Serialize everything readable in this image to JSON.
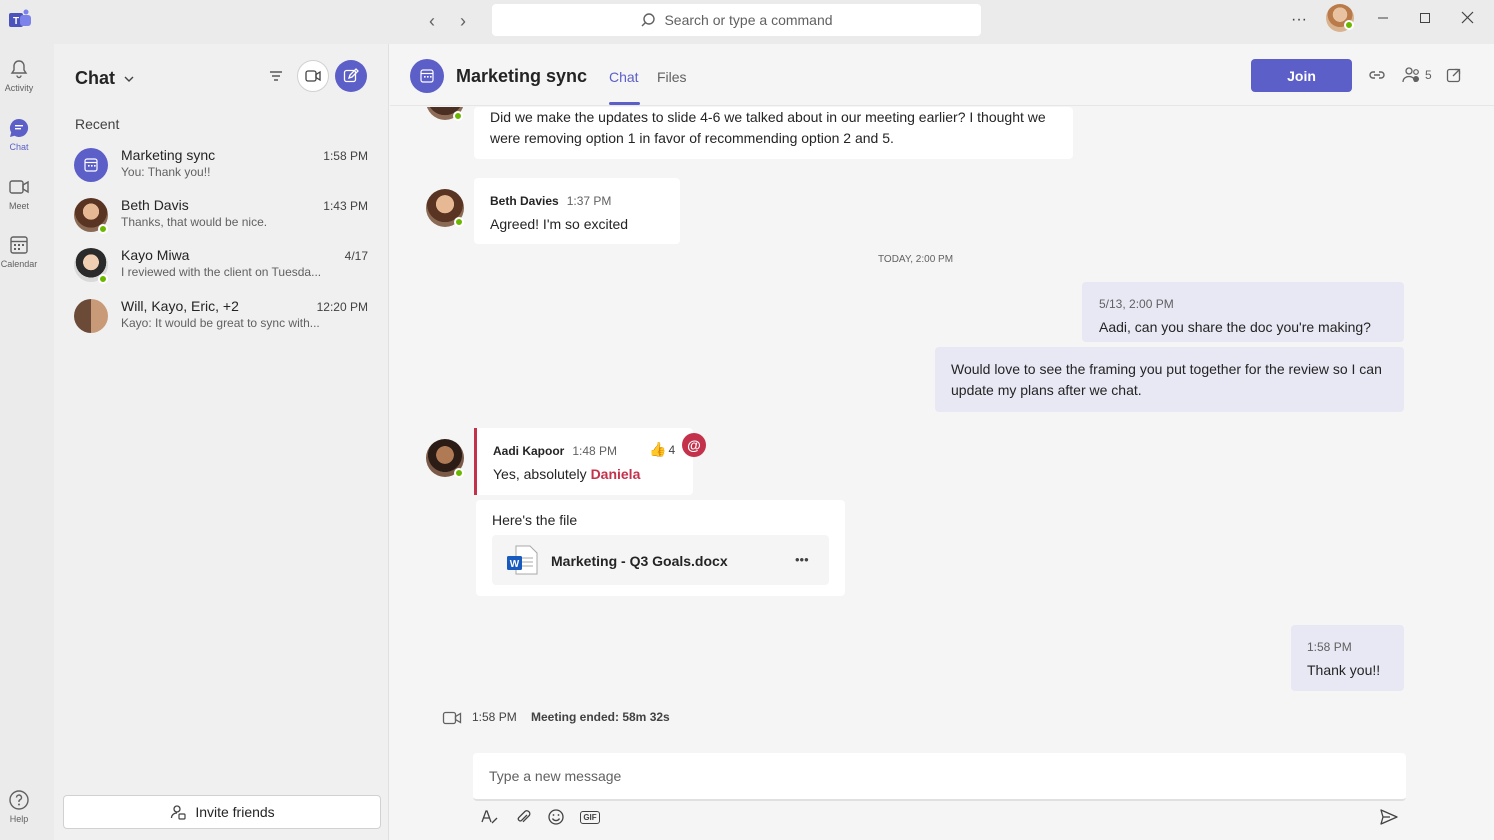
{
  "titlebar": {
    "search_placeholder": "Search or type a command",
    "more": "···"
  },
  "rail": {
    "items": [
      {
        "label": "Activity"
      },
      {
        "label": "Chat"
      },
      {
        "label": "Meet"
      },
      {
        "label": "Calendar"
      },
      {
        "label": "Help"
      }
    ]
  },
  "chatlist": {
    "title": "Chat",
    "recent_label": "Recent",
    "chats": [
      {
        "name": "Marketing sync",
        "preview": "You: Thank you!!",
        "time": "1:58 PM"
      },
      {
        "name": "Beth Davis",
        "preview": "Thanks, that would be nice.",
        "time": "1:43 PM"
      },
      {
        "name": "Kayo Miwa",
        "preview": "I reviewed with the client on Tuesda...",
        "time": "4/17"
      },
      {
        "name": "Will, Kayo, Eric, +2",
        "preview": "Kayo: It would be great to sync with...",
        "time": "12:20 PM"
      }
    ],
    "invite_label": "Invite friends"
  },
  "header": {
    "title": "Marketing sync",
    "tabs": [
      {
        "label": "Chat"
      },
      {
        "label": "Files"
      }
    ],
    "join_label": "Join",
    "participants_count": "5"
  },
  "messages": {
    "m1_text": "Did we make the updates to slide 4-6 we talked about in our meeting earlier? I thought we were removing option 1 in favor of recommending option 2 and 5.",
    "m2": {
      "sender": "Beth Davies",
      "time": "1:37 PM",
      "text": "Agreed! I'm so excited"
    },
    "day_divider": "TODAY, 2:00 PM",
    "m3": {
      "time": "5/13, 2:00 PM",
      "text": "Aadi, can you share the doc you're making?"
    },
    "m4": {
      "text": "Would love to see the framing you put together for the review so I can update my plans after we chat."
    },
    "m5": {
      "sender": "Aadi Kapoor",
      "time": "1:48 PM",
      "text": "Yes, absolutely",
      "mention": "Daniela",
      "reaction_count": "4"
    },
    "m6": {
      "text": "Here's the file",
      "file_name": "Marketing - Q3 Goals.docx",
      "file_more": "•••"
    },
    "m7": {
      "time": "1:58 PM",
      "text": "Thank you!!"
    },
    "meeting": {
      "time": "1:58 PM",
      "text": "Meeting ended: 58m 32s"
    }
  },
  "compose": {
    "placeholder": "Type a new message",
    "gif": "GIF"
  },
  "colors": {
    "brand": "#5b5fc7",
    "mention": "#c4314b",
    "presence": "#6bb700"
  }
}
